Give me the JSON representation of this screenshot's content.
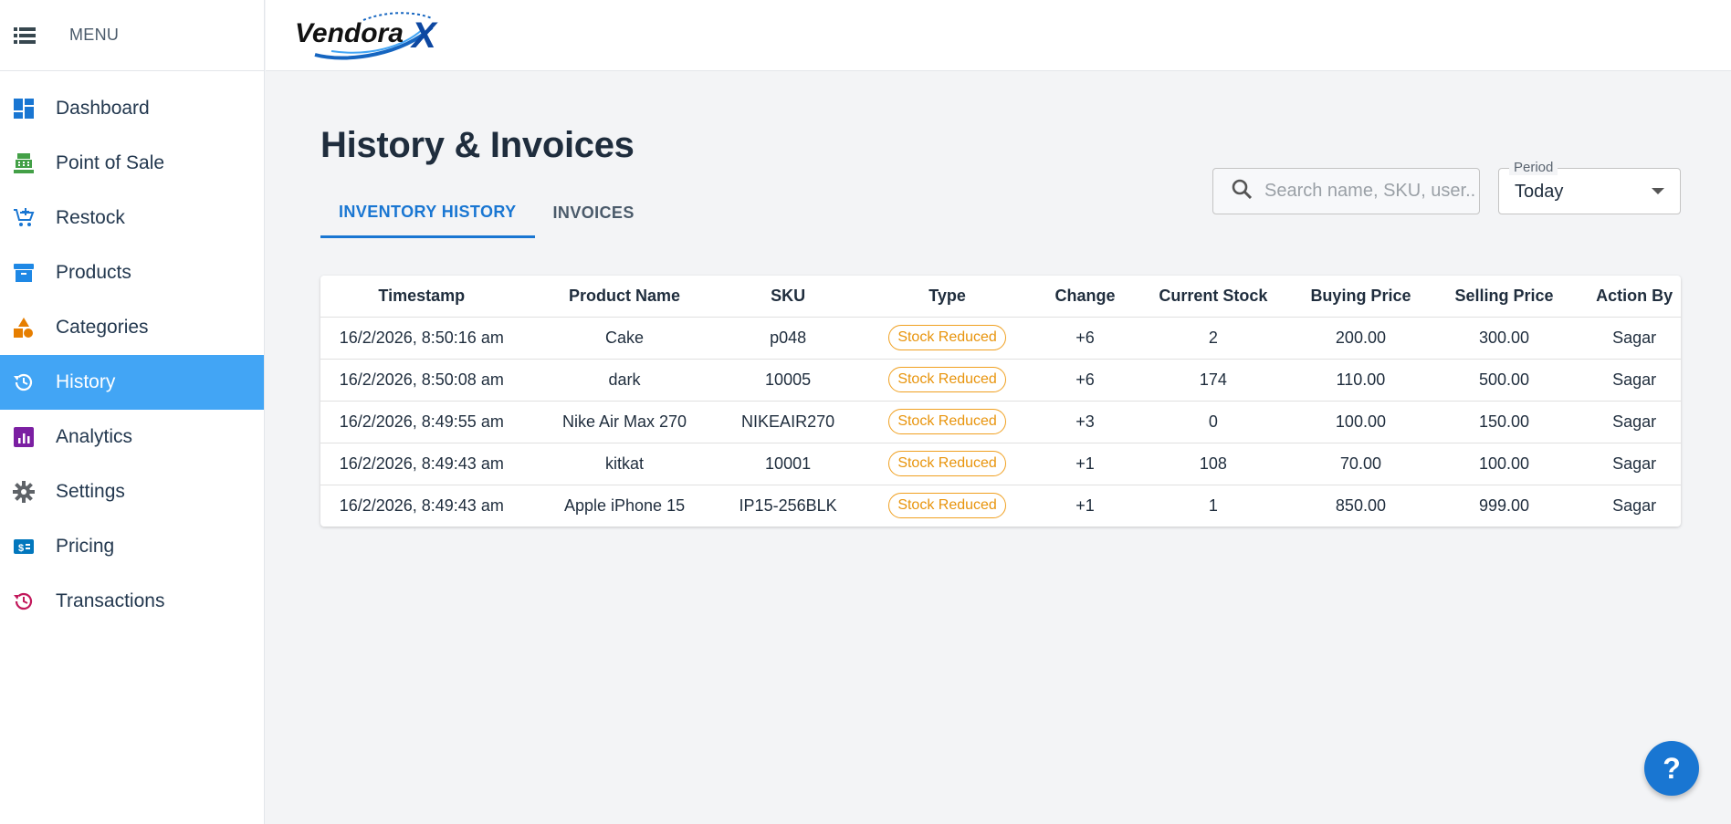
{
  "sidebar": {
    "menu_label": "MENU",
    "items": [
      {
        "label": "Dashboard",
        "icon": "dashboard-icon"
      },
      {
        "label": "Point of Sale",
        "icon": "cash-register-icon"
      },
      {
        "label": "Restock",
        "icon": "cart-add-icon"
      },
      {
        "label": "Products",
        "icon": "archive-box-icon"
      },
      {
        "label": "Categories",
        "icon": "shapes-icon"
      },
      {
        "label": "History",
        "icon": "history-icon",
        "active": true
      },
      {
        "label": "Analytics",
        "icon": "analytics-icon"
      },
      {
        "label": "Settings",
        "icon": "gear-icon"
      },
      {
        "label": "Pricing",
        "icon": "price-tag-icon"
      },
      {
        "label": "Transactions",
        "icon": "transactions-history-icon"
      }
    ]
  },
  "brand": {
    "logo_text": "Vendora",
    "logo_mark": "X"
  },
  "page": {
    "title": "History & Invoices"
  },
  "tabs": [
    {
      "label": "INVENTORY HISTORY",
      "active": true
    },
    {
      "label": "INVOICES",
      "active": false
    }
  ],
  "search": {
    "placeholder": "Search name, SKU, user...",
    "value": ""
  },
  "period": {
    "label": "Period",
    "value": "Today"
  },
  "table": {
    "columns": [
      "Timestamp",
      "Product Name",
      "SKU",
      "Type",
      "Change",
      "Current Stock",
      "Buying Price",
      "Selling Price",
      "Action By"
    ],
    "rows": [
      [
        "16/2/2026, 8:50:16 am",
        "Cake",
        "p048",
        "Stock Reduced",
        "+6",
        "2",
        "200.00",
        "300.00",
        "Sagar"
      ],
      [
        "16/2/2026, 8:50:08 am",
        "dark",
        "10005",
        "Stock Reduced",
        "+6",
        "174",
        "110.00",
        "500.00",
        "Sagar"
      ],
      [
        "16/2/2026, 8:49:55 am",
        "Nike Air Max 270",
        "NIKEAIR270",
        "Stock Reduced",
        "+3",
        "0",
        "100.00",
        "150.00",
        "Sagar"
      ],
      [
        "16/2/2026, 8:49:43 am",
        "kitkat",
        "10001",
        "Stock Reduced",
        "+1",
        "108",
        "70.00",
        "100.00",
        "Sagar"
      ],
      [
        "16/2/2026, 8:49:43 am",
        "Apple iPhone 15",
        "IP15-256BLK",
        "Stock Reduced",
        "+1",
        "1",
        "850.00",
        "999.00",
        "Sagar"
      ]
    ]
  },
  "help": {
    "label": "?"
  },
  "colors": {
    "accent": "#1976d2",
    "active_nav": "#42a5f5",
    "chip_warning": "#f0a020",
    "background": "#f3f4f6"
  }
}
